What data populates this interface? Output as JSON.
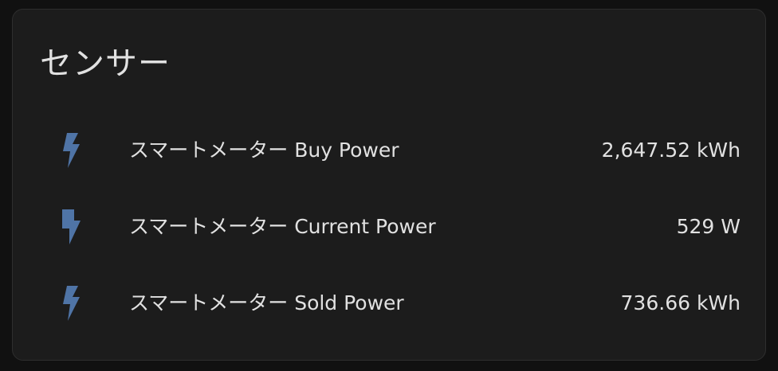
{
  "card": {
    "title": "センサー"
  },
  "colors": {
    "background": "#111111",
    "card_background": "#1c1c1c",
    "text": "#e1e1e1",
    "icon": "#4f74a6"
  },
  "entities": [
    {
      "icon": "flash-icon",
      "name": "スマートメーター Buy Power",
      "state": "2,647.52 kWh"
    },
    {
      "icon": "flash-solid-icon",
      "name": "スマートメーター Current Power",
      "state": "529 W"
    },
    {
      "icon": "flash-icon",
      "name": "スマートメーター Sold Power",
      "state": "736.66 kWh"
    }
  ]
}
